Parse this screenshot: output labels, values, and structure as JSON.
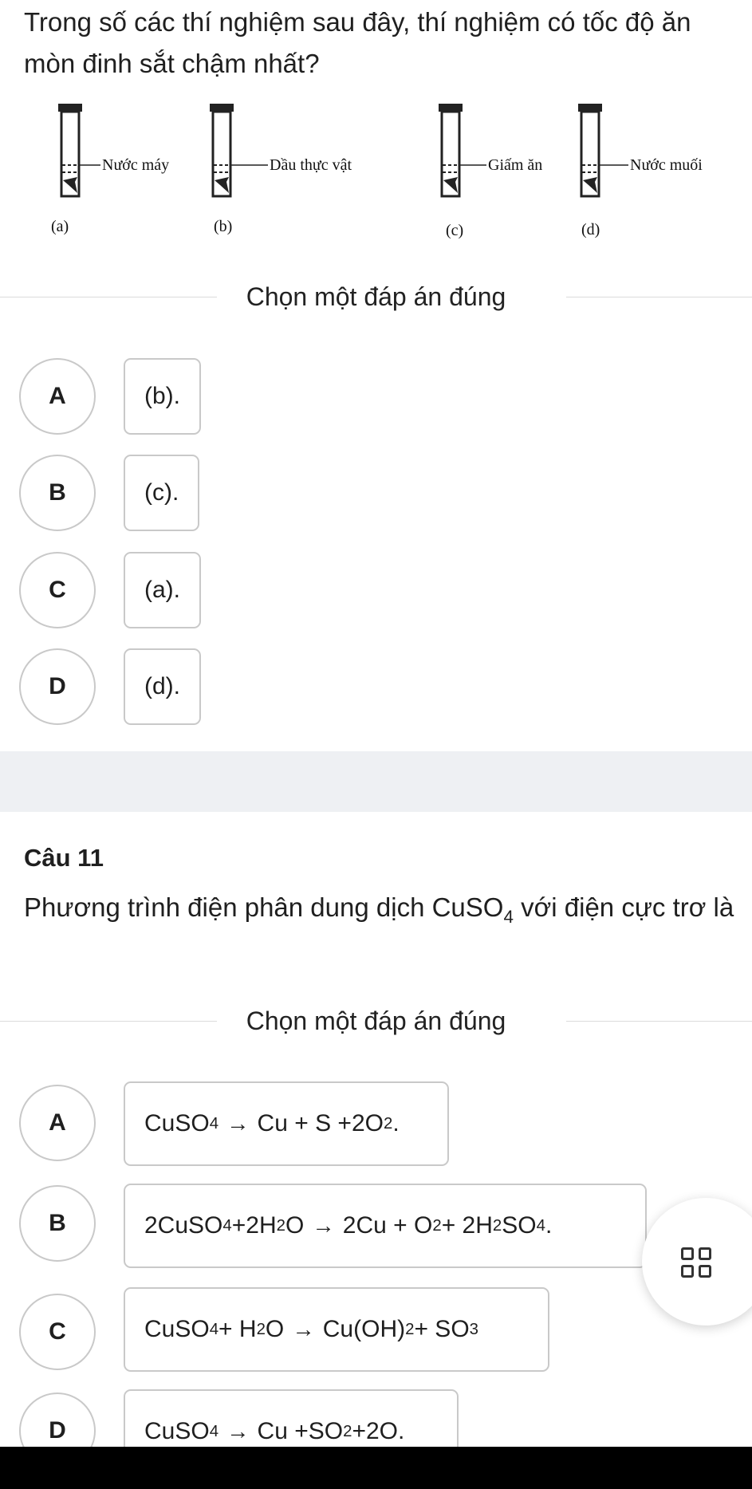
{
  "q1": {
    "text": "Trong số các thí nghiệm sau đây, thí nghiệm có tốc độ ăn mòn đinh sắt chậm nhất?",
    "figure": {
      "tubes": [
        {
          "label": "Nước máy",
          "tag": "(a)"
        },
        {
          "label": "Dầu thực vật",
          "tag": "(b)"
        },
        {
          "label": "Giấm ăn",
          "tag": "(c)"
        },
        {
          "label": "Nước muối",
          "tag": "(d)"
        }
      ]
    },
    "section_title": "Chọn một đáp án đúng",
    "options": [
      {
        "letter": "A",
        "text": "(b)."
      },
      {
        "letter": "B",
        "text": "(c)."
      },
      {
        "letter": "C",
        "text": "(a)."
      },
      {
        "letter": "D",
        "text": "(d)."
      }
    ]
  },
  "q11": {
    "number": "Câu 11",
    "text_before": "Phương trình điện phân dung dịch CuSO",
    "text_sub": "4",
    "text_after": " với điện cực trơ là",
    "section_title": "Chọn một đáp án đúng",
    "options": [
      {
        "letter": "A",
        "parts": [
          "CuSO",
          "4",
          "→",
          "Cu + S +2O",
          "2",
          "."
        ]
      },
      {
        "letter": "B",
        "parts": [
          "2CuSO",
          "4",
          " +2H",
          "2",
          "O",
          "→",
          "2Cu + O",
          "2",
          " + 2H",
          "2",
          "SO",
          "4",
          "."
        ]
      },
      {
        "letter": "C",
        "parts": [
          "CuSO",
          "4",
          " + H",
          "2",
          "O",
          "→",
          "Cu(OH)",
          "2",
          "+ SO",
          "3"
        ]
      },
      {
        "letter": "D",
        "parts": [
          "CuSO",
          "4",
          "→",
          "Cu +SO",
          "2",
          " +2O."
        ]
      }
    ]
  },
  "floating_button": {
    "icon": "grid-icon"
  }
}
